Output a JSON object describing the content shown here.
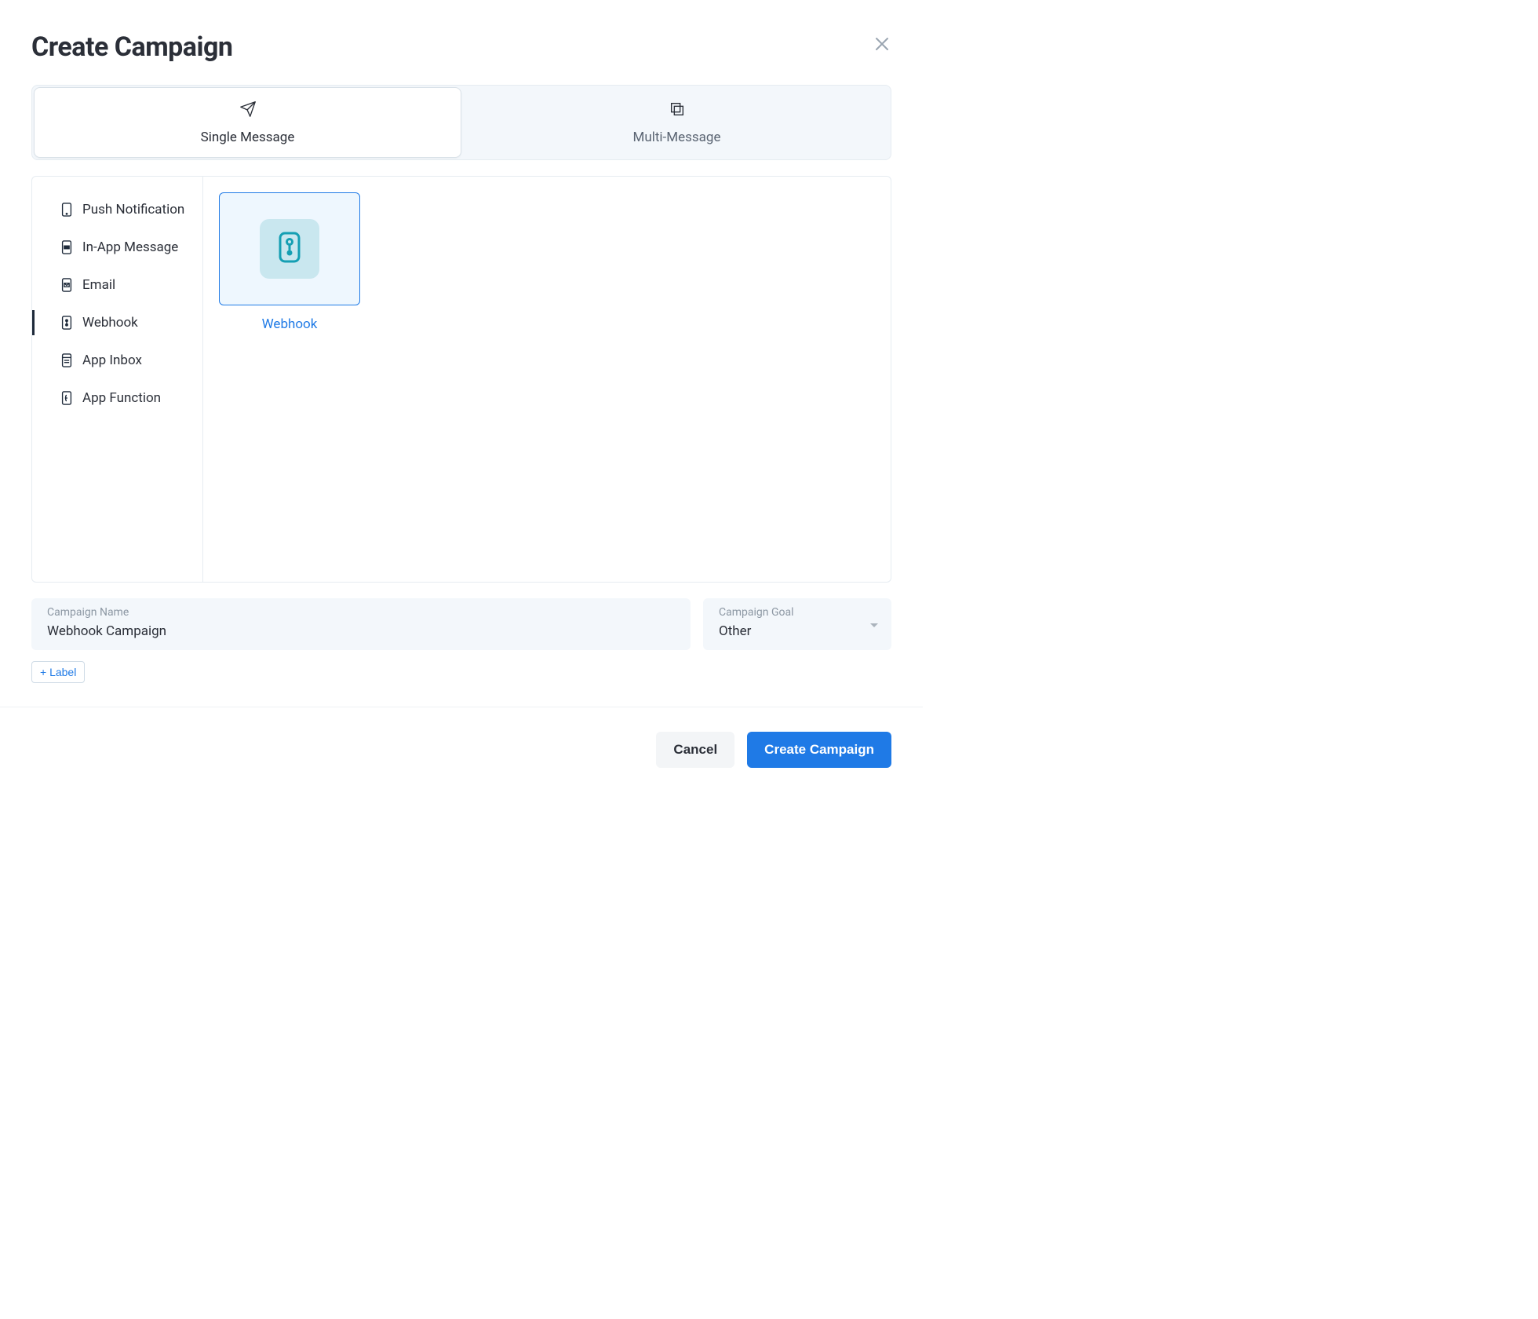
{
  "modal": {
    "title": "Create Campaign"
  },
  "message_type_tabs": [
    {
      "id": "single",
      "label": "Single Message",
      "active": true
    },
    {
      "id": "multi",
      "label": "Multi-Message",
      "active": false
    }
  ],
  "channels": [
    {
      "id": "push",
      "label": "Push Notification",
      "active": false
    },
    {
      "id": "inapp",
      "label": "In-App Message",
      "active": false
    },
    {
      "id": "email",
      "label": "Email",
      "active": false
    },
    {
      "id": "webhook",
      "label": "Webhook",
      "active": true
    },
    {
      "id": "inbox",
      "label": "App Inbox",
      "active": false
    },
    {
      "id": "function",
      "label": "App Function",
      "active": false
    }
  ],
  "selected_card": {
    "label": "Webhook"
  },
  "form": {
    "campaign_name": {
      "label": "Campaign Name",
      "value": "Webhook Campaign"
    },
    "campaign_goal": {
      "label": "Campaign Goal",
      "value": "Other"
    },
    "add_label_button": "+ Label"
  },
  "footer": {
    "cancel": "Cancel",
    "create": "Create Campaign"
  }
}
